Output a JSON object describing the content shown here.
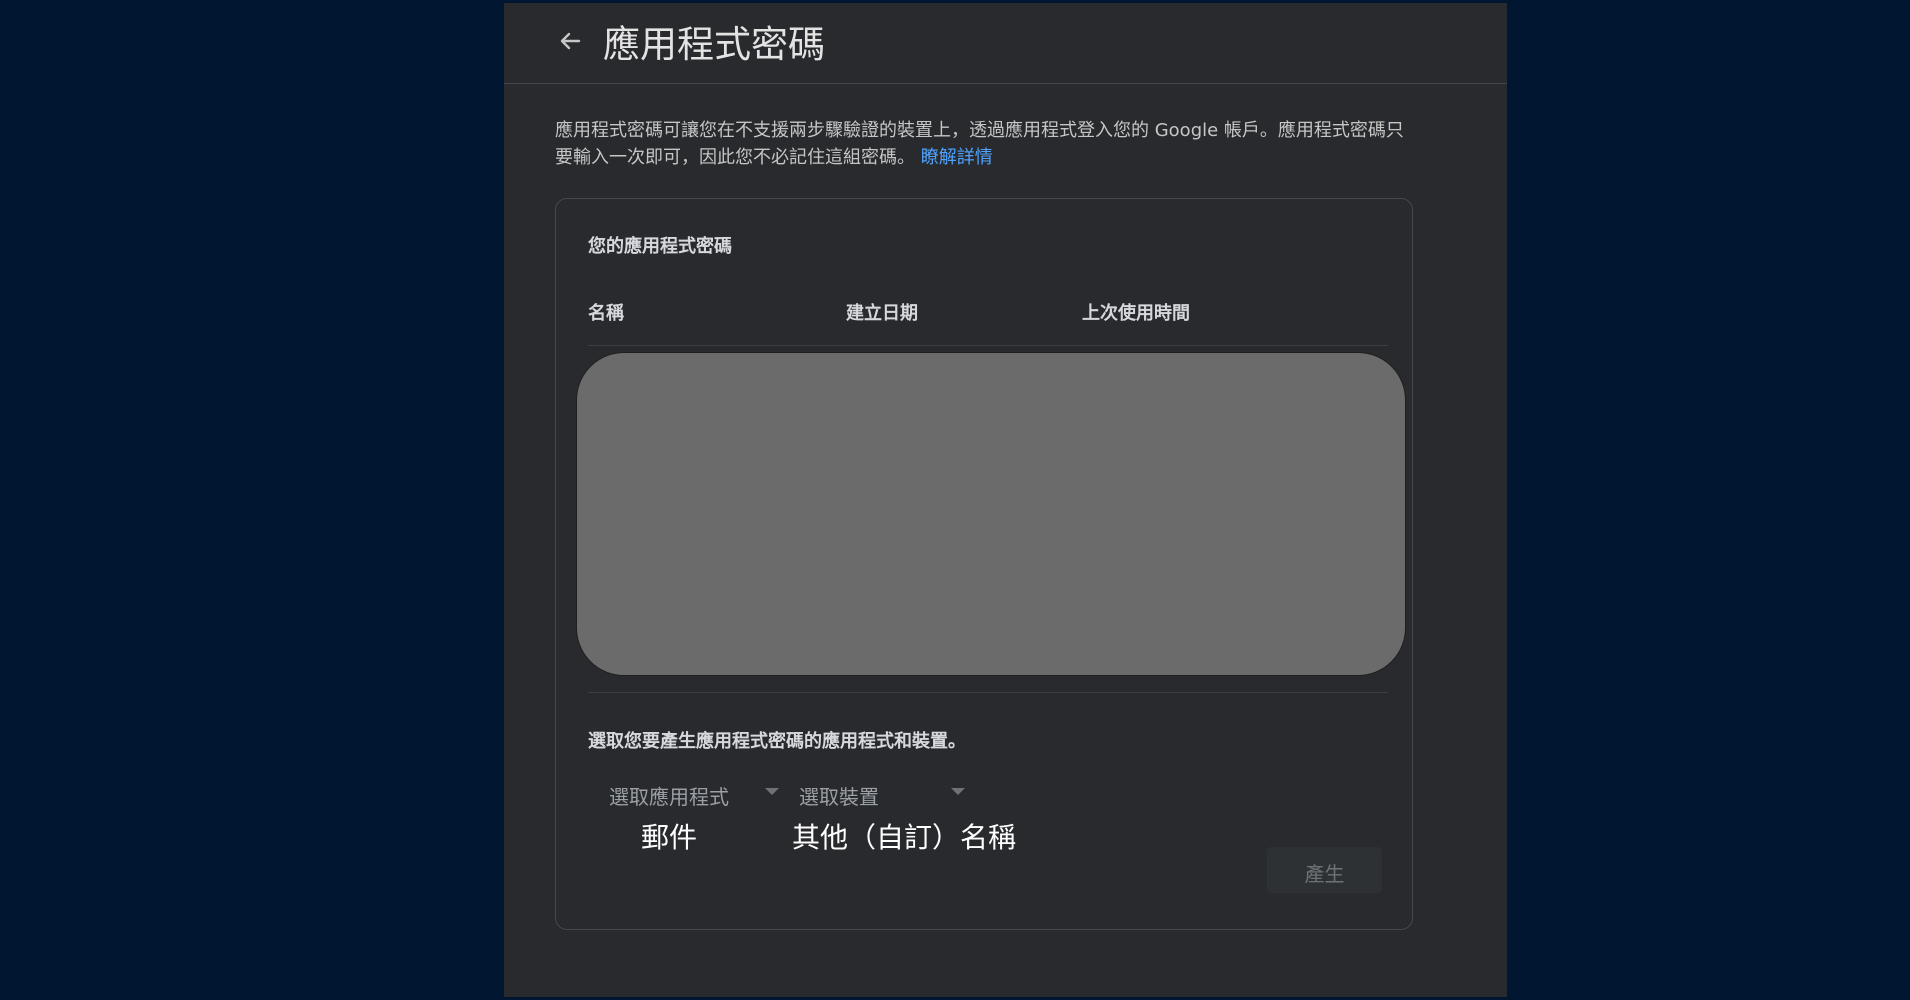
{
  "header": {
    "back_icon": "arrow-left-icon",
    "title": "應用程式密碼"
  },
  "intro": {
    "text": "應用程式密碼可讓您在不支援兩步驟驗證的裝置上，透過應用程式登入您的 Google 帳戶。應用程式密碼只要輸入一次即可，因此您不必記住這組密碼。",
    "learn_more": "瞭解詳情"
  },
  "passwords": {
    "title": "您的應用程式密碼",
    "columns": [
      "名稱",
      "建立日期",
      "上次使用時間"
    ]
  },
  "generator": {
    "prompt": "選取您要產生應用程式密碼的應用程式和裝置。",
    "app_dropdown": {
      "label": "選取應用程式",
      "value": "郵件"
    },
    "device_dropdown": {
      "label": "選取裝置",
      "value": "其他（自訂）名稱"
    },
    "generate_label": "產生"
  },
  "colors": {
    "page_background": "#001631",
    "panel_background": "#282a2d",
    "link": "#4fa3ff",
    "redaction": "#6b6b6b"
  }
}
